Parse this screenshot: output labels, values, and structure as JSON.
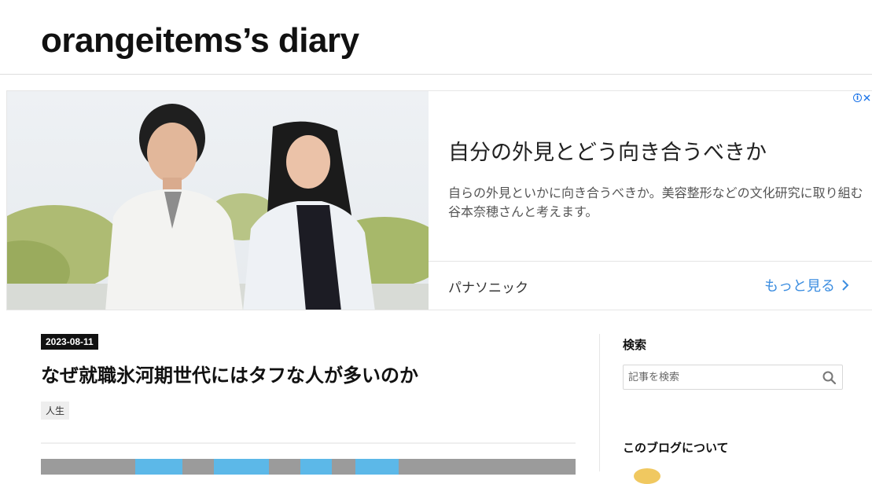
{
  "header": {
    "blog_title": "orangeitems’s diary"
  },
  "ad": {
    "headline": "自分の外見とどう向き合うべきか",
    "description": "自らの外見といかに向き合うべきか。美容整形などの文化研究に取り組む谷本奈穂さんと考えます。",
    "advertiser": "パナソニック",
    "cta_label": "もっと見る",
    "choices_icon": "info-icon",
    "close_icon": "close-icon"
  },
  "article": {
    "date": "2023-08-11",
    "title": "なぜ就職氷河期世代にはタフな人が多いのか",
    "category": "人生"
  },
  "sidebar": {
    "search_heading": "検索",
    "search_placeholder": "記事を検索",
    "about_heading": "このブログについて"
  },
  "colors": {
    "link_blue": "#3b8de0",
    "badge_black": "#111111",
    "tag_gray": "#eeeeee"
  }
}
